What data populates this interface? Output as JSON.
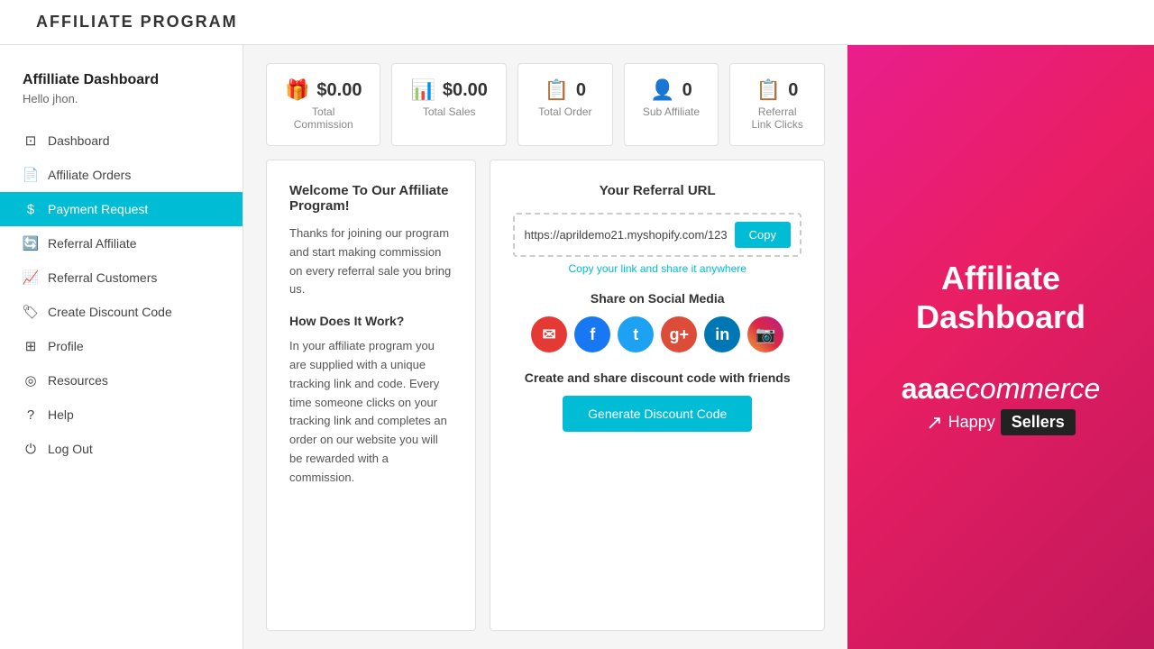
{
  "topBar": {
    "title": "AFFILIATE PROGRAM"
  },
  "sidebar": {
    "dashboardTitle": "Affilliate Dashboard",
    "dashboardSubtitle": "Hello jhon.",
    "navItems": [
      {
        "id": "dashboard",
        "label": "Dashboard",
        "icon": "⊞",
        "active": false
      },
      {
        "id": "affiliate-orders",
        "label": "Affiliate Orders",
        "icon": "🗂",
        "active": false
      },
      {
        "id": "payment-request",
        "label": "Payment Request",
        "icon": "$",
        "active": true
      },
      {
        "id": "referral-affiliate",
        "label": "Referral Affiliate",
        "icon": "⟳",
        "active": false
      },
      {
        "id": "referral-customers",
        "label": "Referral Customers",
        "icon": "📈",
        "active": false
      },
      {
        "id": "create-discount-code",
        "label": "Create Discount Code",
        "icon": "🏷",
        "active": false
      },
      {
        "id": "profile",
        "label": "Profile",
        "icon": "⊞",
        "active": false
      },
      {
        "id": "resources",
        "label": "Resources",
        "icon": "◎",
        "active": false
      },
      {
        "id": "help",
        "label": "Help",
        "icon": "?",
        "active": false
      },
      {
        "id": "log-out",
        "label": "Log Out",
        "icon": "⏻",
        "active": false
      }
    ]
  },
  "stats": [
    {
      "icon": "🎁",
      "iconColor": "#e53935",
      "value": "$0.00",
      "label": "Total Commission"
    },
    {
      "icon": "📊",
      "iconColor": "#4caf50",
      "value": "$0.00",
      "label": "Total Sales"
    },
    {
      "icon": "📋",
      "iconColor": "#ff9800",
      "value": "0",
      "label": "Total Order"
    },
    {
      "icon": "👤",
      "iconColor": "#9c27b0",
      "value": "0",
      "label": "Sub Affiliate"
    },
    {
      "icon": "📋",
      "iconColor": "#ff9800",
      "value": "0",
      "label": "Referral Link Clicks"
    }
  ],
  "welcome": {
    "heading": "Welcome To Our Affiliate Program!",
    "intro": "Thanks for joining our program and start making commission on every referral sale you bring us.",
    "howWorksHeading": "How Does It Work?",
    "howWorksText": "In your affiliate program you are supplied with a unique tracking link and code. Every time someone clicks on your tracking link and completes an order on our website you will be rewarded with a commission."
  },
  "referral": {
    "heading": "Your Referral URL",
    "url": "https://aprildemo21.myshopify.com/123",
    "copyLabel": "Copy",
    "copyHint": "Copy your link and share it anywhere",
    "socialHeading": "Share on Social Media",
    "discountHeading": "Create and share discount code with friends",
    "generateLabel": "Generate Discount Code"
  },
  "branding": {
    "title": "Affiliate Dashboard",
    "aaaText": "aaa",
    "ecommerceText": "ecommerce",
    "happyText": "Happy",
    "sellersText": "Sellers"
  }
}
